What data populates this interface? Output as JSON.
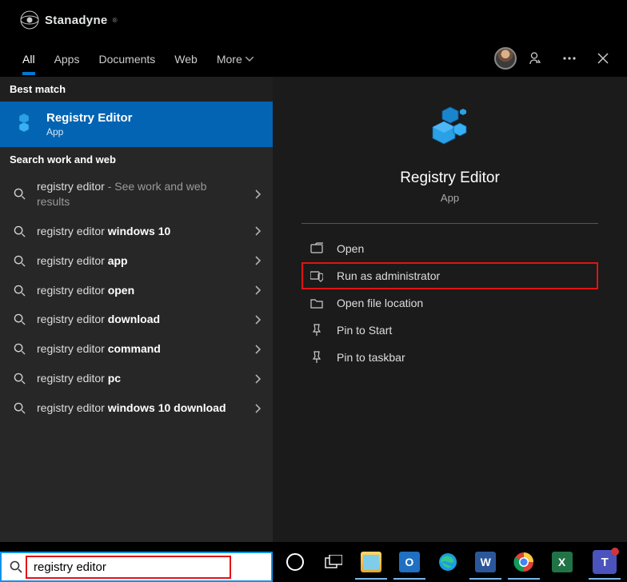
{
  "brand": {
    "name": "Stanadyne"
  },
  "tabs": {
    "all": "All",
    "apps": "Apps",
    "documents": "Documents",
    "web": "Web",
    "more": "More"
  },
  "sections": {
    "best_match": "Best match",
    "search_work_web": "Search work and web"
  },
  "best_match": {
    "title": "Registry Editor",
    "subtitle": "App"
  },
  "suggestions": [
    {
      "prefix": "registry editor",
      "bold": "",
      "suffix": " - See work and web results"
    },
    {
      "prefix": "registry editor ",
      "bold": "windows 10",
      "suffix": ""
    },
    {
      "prefix": "registry editor ",
      "bold": "app",
      "suffix": ""
    },
    {
      "prefix": "registry editor ",
      "bold": "open",
      "suffix": ""
    },
    {
      "prefix": "registry editor ",
      "bold": "download",
      "suffix": ""
    },
    {
      "prefix": "registry editor ",
      "bold": "command",
      "suffix": ""
    },
    {
      "prefix": "registry editor ",
      "bold": "pc",
      "suffix": ""
    },
    {
      "prefix": "registry editor ",
      "bold": "windows 10 download",
      "suffix": ""
    }
  ],
  "preview": {
    "title": "Registry Editor",
    "subtitle": "App",
    "actions": {
      "open": "Open",
      "run_admin": "Run as administrator",
      "open_location": "Open file location",
      "pin_start": "Pin to Start",
      "pin_taskbar": "Pin to taskbar"
    }
  },
  "search": {
    "query": "registry editor"
  },
  "colors": {
    "accent": "#0078d4",
    "highlight": "#e11313",
    "bg_left": "#272727",
    "bg_right": "#1b1b1b"
  }
}
